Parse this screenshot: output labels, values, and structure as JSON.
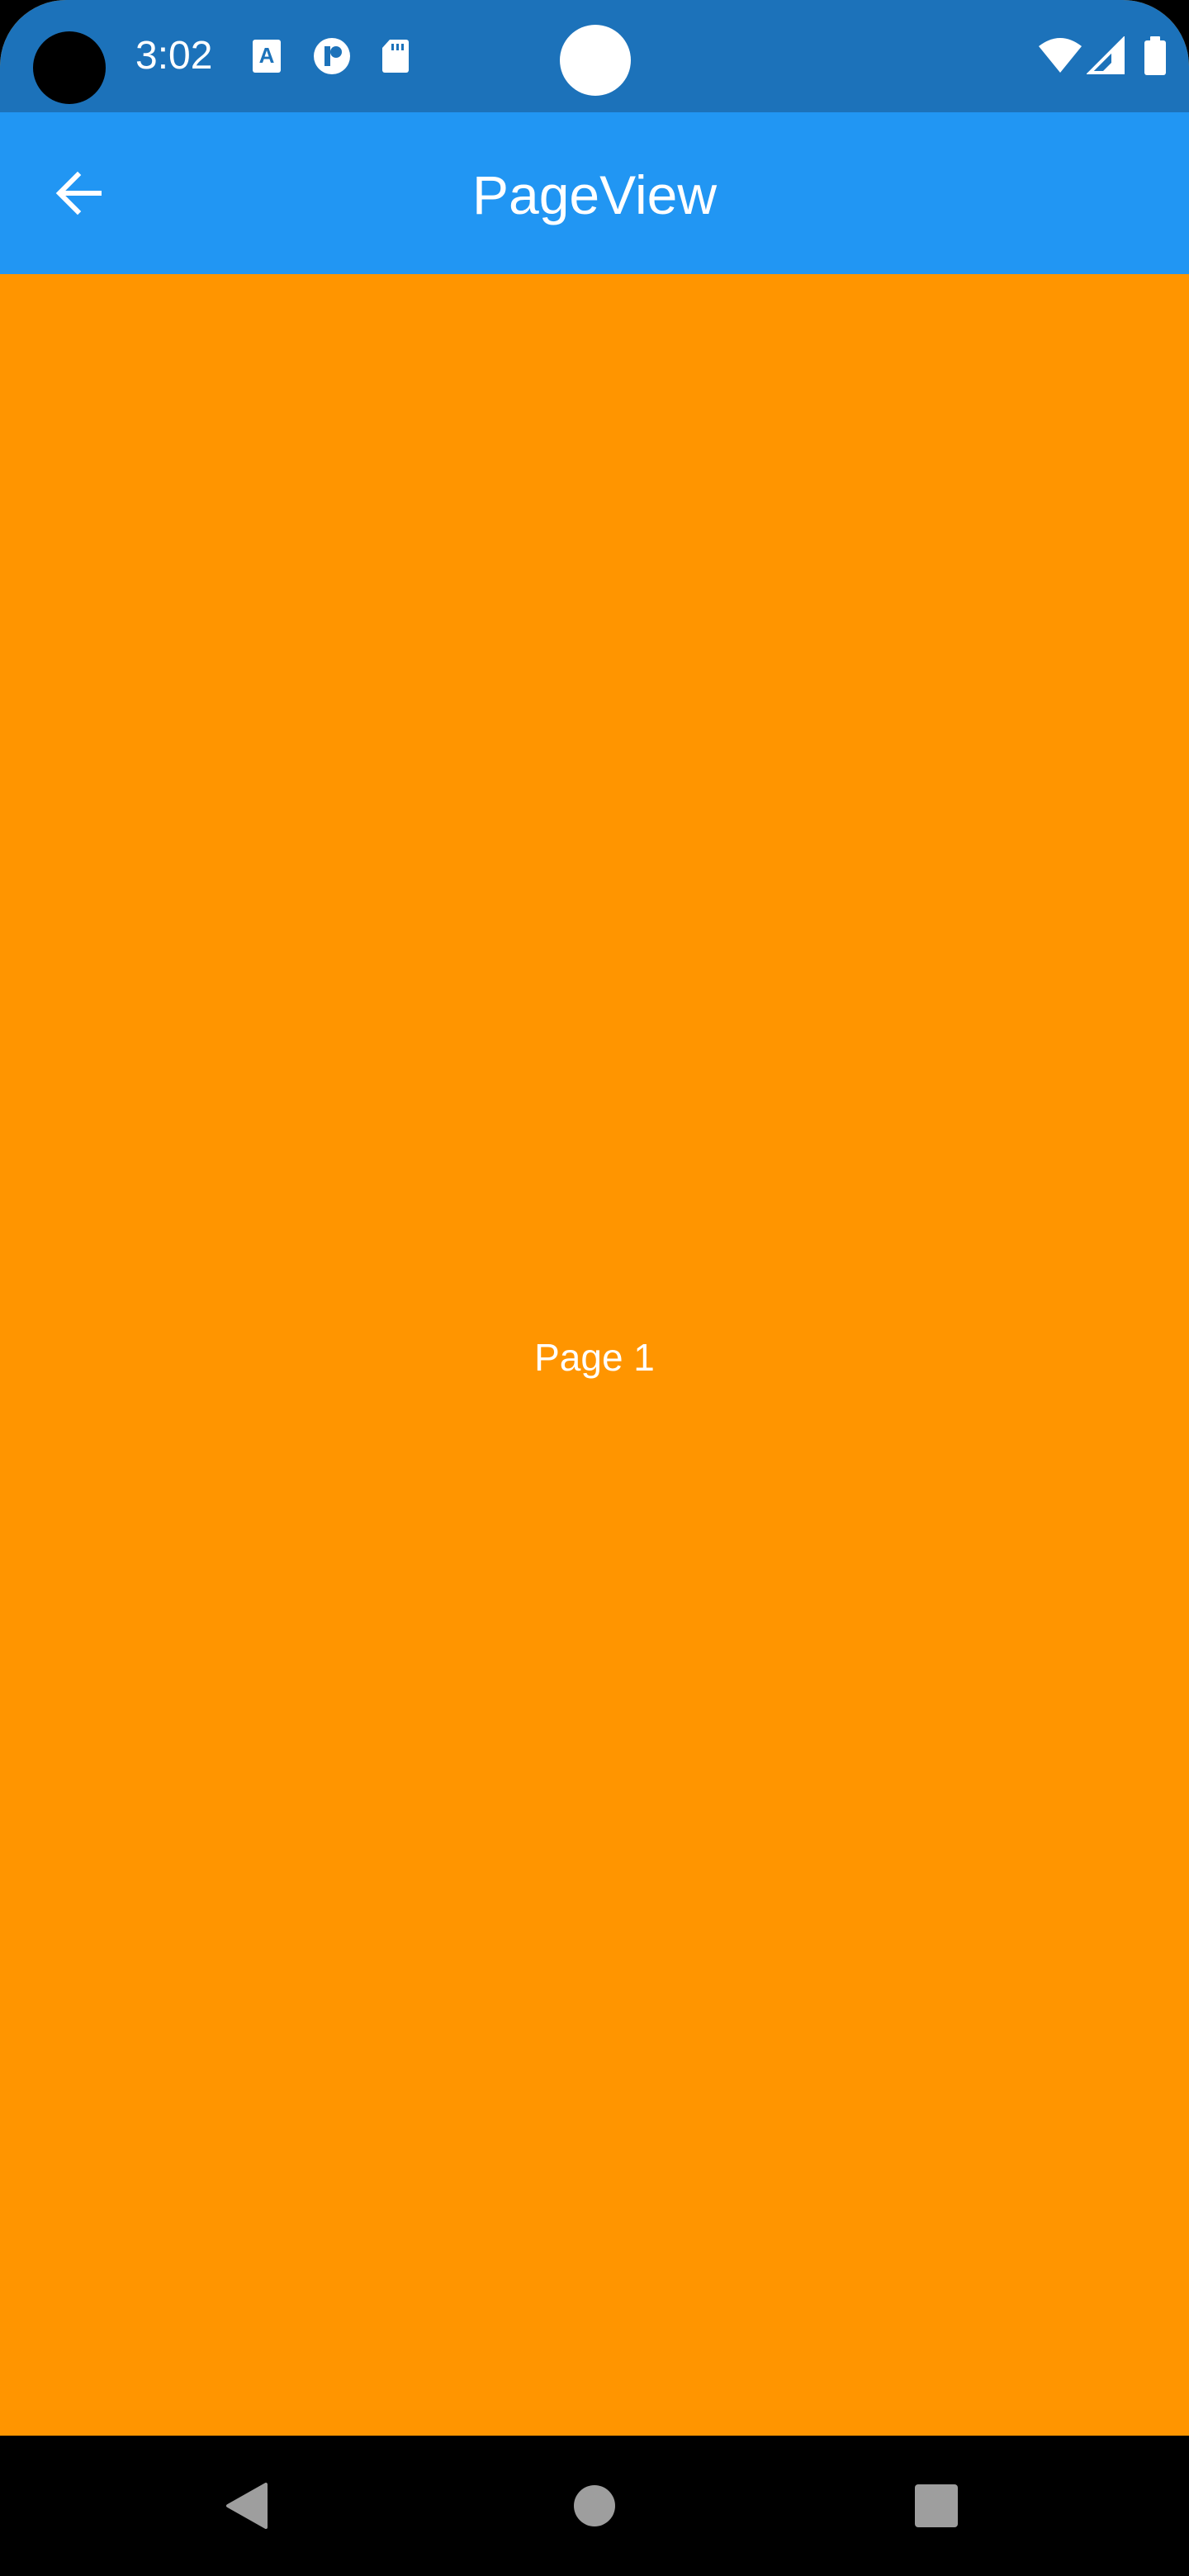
{
  "status_bar": {
    "time": "3:02",
    "icons": [
      "text-a-icon",
      "p-app-icon",
      "sd-card-icon",
      "wifi-icon",
      "signal-icon",
      "battery-icon"
    ],
    "background": "#1C72BA"
  },
  "app_bar": {
    "title": "PageView",
    "back_icon": "arrow-back-icon",
    "background": "#2196F3"
  },
  "page_view": {
    "current_page_label": "Page 1",
    "background": "#FF9500"
  },
  "nav_bar": {
    "buttons": [
      "back-triangle-icon",
      "home-circle-icon",
      "recents-square-icon"
    ],
    "icon_color": "#9E9E9E"
  }
}
